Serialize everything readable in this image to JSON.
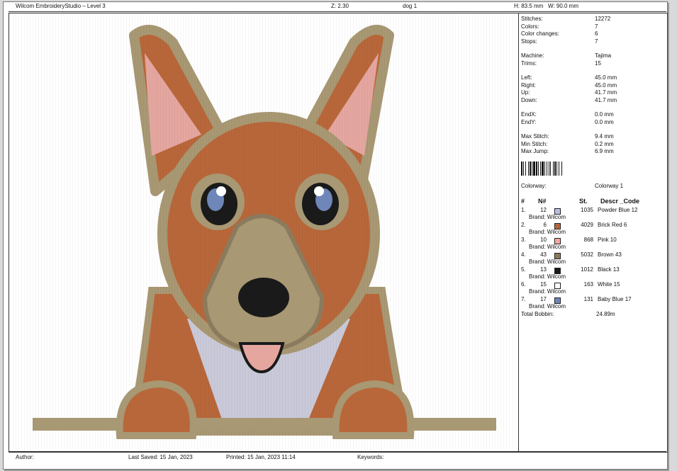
{
  "header": {
    "app_title": "Wilcom EmbroideryStudio – Level 3",
    "zoom": "Z: 2.30",
    "design_name": "dog 1",
    "size": "H: 83.5 mm   W: 90.0 mm"
  },
  "stats": [
    {
      "label": "Stitches:",
      "value": "12272"
    },
    {
      "label": "Colors:",
      "value": "7"
    },
    {
      "label": "Color changes:",
      "value": "6"
    },
    {
      "label": "Stops:",
      "value": "7"
    },
    {
      "gap": true
    },
    {
      "label": "Machine:",
      "value": "Tajima"
    },
    {
      "label": "Trims:",
      "value": "15"
    },
    {
      "gap": true
    },
    {
      "label": "Left:",
      "value": "45.0 mm"
    },
    {
      "label": "Right:",
      "value": "45.0 mm"
    },
    {
      "label": "Up:",
      "value": "41.7 mm"
    },
    {
      "label": "Down:",
      "value": "41.7 mm"
    },
    {
      "gap": true
    },
    {
      "label": "EndX:",
      "value": "0.0 mm"
    },
    {
      "label": "EndY:",
      "value": "0.0 mm"
    },
    {
      "gap": true
    },
    {
      "label": "Max Stitch:",
      "value": "9.4 mm"
    },
    {
      "label": "Min Stitch:",
      "value": "0.2 mm"
    },
    {
      "label": "Max Jump:",
      "value": "6.9 mm"
    }
  ],
  "colorway": {
    "label": "Colorway:",
    "value": "Colorway 1"
  },
  "color_table": {
    "headers": {
      "idx": "#",
      "code": "N#",
      "stitches": "St.",
      "desc": "Descr _Code"
    },
    "rows": [
      {
        "idx": "1.",
        "code": "12",
        "color": "#b9bde0",
        "stitches": "1035",
        "desc": "Powder Blue 12",
        "brand": "Brand: Wilcom"
      },
      {
        "idx": "2.",
        "code": "6",
        "color": "#b8673a",
        "stitches": "4029",
        "desc": "Brick Red 6",
        "brand": "Brand: Wilcom"
      },
      {
        "idx": "3.",
        "code": "10",
        "color": "#f4a7a0",
        "stitches": "868",
        "desc": "Pink 10",
        "brand": "Brand: Wilcom"
      },
      {
        "idx": "4.",
        "code": "43",
        "color": "#8b7b5e",
        "stitches": "5032",
        "desc": "Brown 43",
        "brand": "Brand: Wilcom"
      },
      {
        "idx": "5.",
        "code": "13",
        "color": "#1a1a1a",
        "stitches": "1012",
        "desc": "Black 13",
        "brand": "Brand: Wilcom"
      },
      {
        "idx": "6.",
        "code": "15",
        "color": "#ffffff",
        "stitches": "163",
        "desc": "White 15",
        "brand": "Brand: Wilcom"
      },
      {
        "idx": "7.",
        "code": "17",
        "color": "#6f86b8",
        "stitches": "131",
        "desc": "Baby Blue 17",
        "brand": "Brand: Wilcom"
      }
    ],
    "total_label": "Total Bobbin:",
    "total_value": "24.89m"
  },
  "footer": {
    "author": "Author:",
    "last_saved": "Last Saved: 15 Jan, 2023",
    "printed": "Printed: 15 Jan, 2023 11:14",
    "keywords": "Keywords:"
  }
}
